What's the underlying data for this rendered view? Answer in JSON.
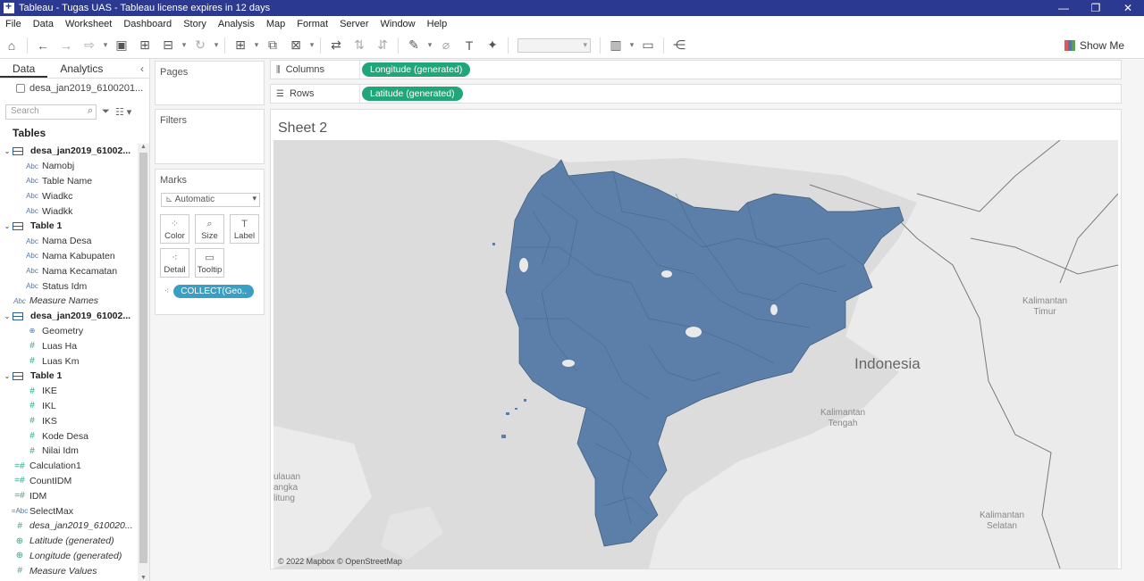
{
  "window": {
    "title": "Tableau - Tugas UAS - Tableau license expires in 12 days",
    "controls": [
      "—",
      "❐",
      "✕"
    ]
  },
  "menu": [
    "File",
    "Data",
    "Worksheet",
    "Dashboard",
    "Story",
    "Analysis",
    "Map",
    "Format",
    "Server",
    "Window",
    "Help"
  ],
  "toolbar": {
    "show_me": "Show Me",
    "icons": [
      "home-icon",
      "undo-icon",
      "redo-icon",
      "replay-icon",
      "save-icon",
      "new-datasource-icon",
      "pause-autoupdate-icon",
      "refresh-icon",
      "new-worksheet-icon",
      "duplicate-icon",
      "clear-icon",
      "swap-icon",
      "sort-ascending-icon",
      "sort-descending-icon",
      "highlight-icon",
      "group-icon",
      "label-icon",
      "pin-icon",
      "show-cards-icon",
      "presentation-icon",
      "share-icon"
    ]
  },
  "data_pane": {
    "tab_data": "Data",
    "tab_analytics": "Analytics",
    "collapse": "‹",
    "datasource": "desa_jan2019_6100201...",
    "search_placeholder": "Search",
    "tables_header": "Tables",
    "fields": [
      {
        "kind": "table",
        "label": "desa_jan2019_61002..."
      },
      {
        "kind": "dim",
        "type": "Abc",
        "label": "Namobj"
      },
      {
        "kind": "dim",
        "type": "Abc",
        "label": "Table Name"
      },
      {
        "kind": "dim",
        "type": "Abc",
        "label": "Wiadkc"
      },
      {
        "kind": "dim",
        "type": "Abc",
        "label": "Wiadkk"
      },
      {
        "kind": "table",
        "label": "Table 1"
      },
      {
        "kind": "dim",
        "type": "Abc",
        "label": "Nama Desa"
      },
      {
        "kind": "dim",
        "type": "Abc",
        "label": "Nama Kabupaten"
      },
      {
        "kind": "dim",
        "type": "Abc",
        "label": "Nama Kecamatan"
      },
      {
        "kind": "dim",
        "type": "Abc",
        "label": "Status Idm"
      },
      {
        "kind": "root",
        "type": "Abc",
        "label": "Measure Names",
        "italic": true
      },
      {
        "kind": "table",
        "label": "desa_jan2019_61002..."
      },
      {
        "kind": "dim",
        "type": "⊕",
        "label": "Geometry"
      },
      {
        "kind": "meas",
        "type": "#",
        "label": "Luas Ha"
      },
      {
        "kind": "meas",
        "type": "#",
        "label": "Luas Km"
      },
      {
        "kind": "table",
        "label": "Table 1"
      },
      {
        "kind": "meas",
        "type": "#",
        "label": "IKE"
      },
      {
        "kind": "meas",
        "type": "#",
        "label": "IKL"
      },
      {
        "kind": "meas",
        "type": "#",
        "label": "IKS"
      },
      {
        "kind": "meas",
        "type": "#",
        "label": "Kode Desa"
      },
      {
        "kind": "meas",
        "type": "#",
        "label": "Nilai Idm"
      },
      {
        "kind": "rootm",
        "type": "=#",
        "label": "Calculation1"
      },
      {
        "kind": "rootm",
        "type": "=#",
        "label": "CountIDM"
      },
      {
        "kind": "rootm",
        "type": "=#",
        "label": "IDM"
      },
      {
        "kind": "root",
        "type": "=Abc",
        "label": "SelectMax"
      },
      {
        "kind": "rootm",
        "type": "#",
        "label": "desa_jan2019_610020...",
        "italic": true
      },
      {
        "kind": "rootm",
        "type": "⊕",
        "label": "Latitude (generated)",
        "italic": true
      },
      {
        "kind": "rootm",
        "type": "⊕",
        "label": "Longitude (generated)",
        "italic": true
      },
      {
        "kind": "rootm",
        "type": "#",
        "label": "Measure Values",
        "italic": true
      }
    ]
  },
  "cards": {
    "pages": "Pages",
    "filters": "Filters",
    "marks": "Marks",
    "mark_type": "Automatic",
    "buttons": {
      "color": "Color",
      "size": "Size",
      "label": "Label",
      "detail": "Detail",
      "tooltip": "Tooltip"
    },
    "detail_pill": "COLLECT(Geo.."
  },
  "shelves": {
    "columns_label": "Columns",
    "columns_pill": "Longitude (generated)",
    "rows_label": "Rows",
    "rows_pill": "Latitude (generated)"
  },
  "sheet": {
    "title": "Sheet 2",
    "map_labels": {
      "country": "Indonesia",
      "kaltim": "Kalimantan\nTimur",
      "kalteng": "Kalimantan\nTengah",
      "kalsel": "Kalimantan\nSelatan",
      "belitung": "ulauan\nangka\nlitung"
    },
    "credit": "© 2022 Mapbox © OpenStreetMap",
    "fill_color": "#5b7fa8"
  }
}
